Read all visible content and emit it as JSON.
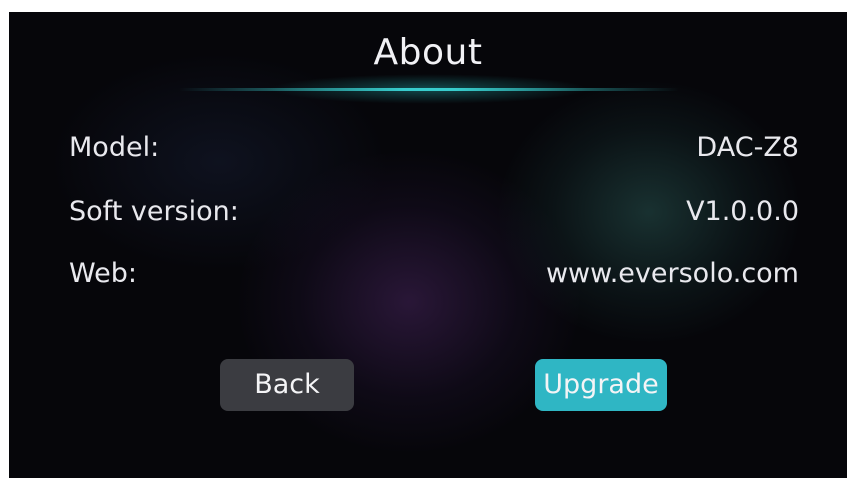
{
  "screen": {
    "title": "About",
    "accent_color": "#2fb6c4",
    "background_color": "#06060a"
  },
  "info": {
    "model_label": "Model:",
    "model_value": "DAC-Z8",
    "soft_version_label": "Soft version:",
    "soft_version_value": "V1.0.0.0",
    "web_label": "Web:",
    "web_value": "www.eversolo.com"
  },
  "buttons": {
    "back_label": "Back",
    "upgrade_label": "Upgrade"
  }
}
